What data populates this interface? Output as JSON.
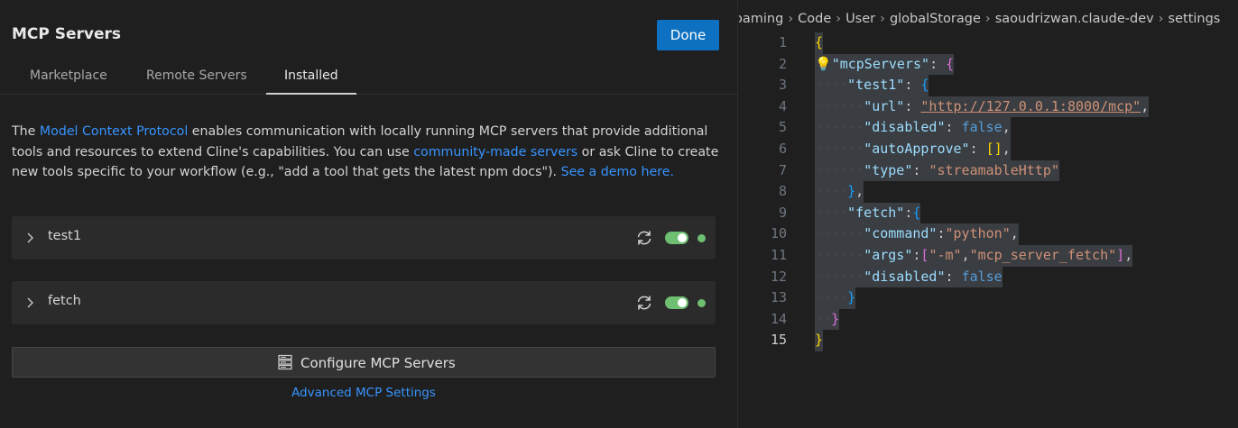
{
  "panel": {
    "title": "MCP Servers",
    "done_label": "Done",
    "tabs": [
      "Marketplace",
      "Remote Servers",
      "Installed"
    ],
    "active_tab": "Installed",
    "description": {
      "t1": "The ",
      "link1": "Model Context Protocol",
      "t2": " enables communication with locally running MCP servers that provide additional tools and resources to extend Cline's capabilities. You can use ",
      "link2": "community-made servers",
      "t3": " or ask Cline to create new tools specific to your workflow (e.g., \"add a tool that gets the latest npm docs\"). ",
      "link3": "See a demo here."
    },
    "servers": [
      {
        "name": "test1",
        "enabled": true,
        "status": "connected"
      },
      {
        "name": "fetch",
        "enabled": true,
        "status": "connected"
      }
    ],
    "configure_label": "Configure MCP Servers",
    "advanced_label": "Advanced MCP Settings"
  },
  "editor": {
    "breadcrumbs": [
      "oaming",
      "Code",
      "User",
      "globalStorage",
      "saoudrizwan.claude-dev",
      "settings"
    ],
    "line_numbers": [
      "1",
      "2",
      "3",
      "4",
      "5",
      "6",
      "7",
      "8",
      "9",
      "10",
      "11",
      "12",
      "13",
      "14",
      "15"
    ],
    "current_line": "15",
    "code": {
      "mcpServers_key": "\"mcpServers\"",
      "test1_key": "\"test1\"",
      "url_key": "\"url\"",
      "url_val": "\"http://127.0.0.1:8000/mcp\"",
      "disabled_key": "\"disabled\"",
      "false_val": "false",
      "autoApprove_key": "\"autoApprove\"",
      "empty_array": "[]",
      "type_key": "\"type\"",
      "type_val": "\"streamableHttp\"",
      "fetch_key": "\"fetch\"",
      "command_key": "\"command\"",
      "command_val": "\"python\"",
      "args_key": "\"args\"",
      "arg1": "\"-m\"",
      "arg2": "\"mcp_server_fetch\""
    }
  },
  "colors": {
    "accent": "#0e70c0",
    "link": "#3794ff",
    "status_green": "#6fbf73",
    "json_key": "#9cdcfe",
    "json_string": "#ce9178",
    "json_keyword": "#569cd6"
  }
}
